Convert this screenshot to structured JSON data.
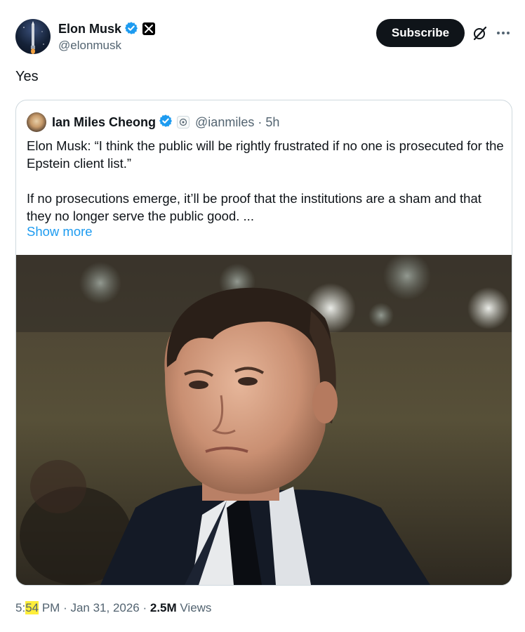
{
  "post": {
    "author_name": "Elon Musk",
    "author_handle": "@elonmusk",
    "subscribe_label": "Subscribe",
    "text": "Yes",
    "icons": {
      "verified": "verified-badge-icon",
      "affiliation": "x-logo-icon",
      "grok": "grok-icon",
      "more": "more-icon"
    }
  },
  "quote": {
    "author_name": "Ian Miles Cheong",
    "author_handle": "@ianmiles",
    "separator": "·",
    "time": "5h",
    "paragraph1": "Elon Musk: “I think the public will be rightly frustrated if no one is prosecuted for the Epstein client list.”",
    "paragraph2": "If no prosecutions emerge, it’ll be proof that the institutions are a sham and that they no longer serve the public good. ...",
    "show_more": "Show more"
  },
  "meta": {
    "time_prefix": "5:",
    "time_highlight": "54",
    "time_suffix": " PM",
    "sep1": " · ",
    "date": "Jan 31, 2026",
    "sep2": " · ",
    "views_count": "2.5M",
    "views_label": " Views"
  },
  "colors": {
    "verified": "#1d9bf0",
    "link": "#1d9bf0",
    "secondary_text": "#536471",
    "highlight": "#ffee3a"
  }
}
